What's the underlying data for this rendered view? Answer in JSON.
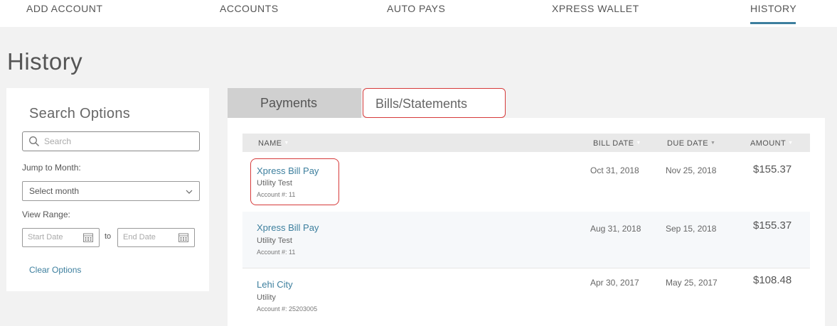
{
  "nav": {
    "items": [
      "ADD ACCOUNT",
      "ACCOUNTS",
      "AUTO PAYS",
      "XPRESS WALLET",
      "HISTORY"
    ],
    "active": "HISTORY"
  },
  "page_title": "History",
  "search_options": {
    "title": "Search Options",
    "search_placeholder": "Search",
    "jump_label": "Jump to Month:",
    "month_select": "Select month",
    "range_label": "View Range:",
    "start_placeholder": "Start Date",
    "to_label": "to",
    "end_placeholder": "End Date",
    "clear_label": "Clear Options"
  },
  "tabs": {
    "payments": "Payments",
    "bills": "Bills/Statements",
    "active": "Bills/Statements"
  },
  "table": {
    "columns": {
      "name": "NAME",
      "bill_date": "BILL DATE",
      "due_date": "DUE DATE",
      "amount": "AMOUNT"
    },
    "rows": [
      {
        "name": "Xpress Bill Pay",
        "sub": "Utility Test",
        "account": "Account #: 11",
        "bill_date": "Oct 31, 2018",
        "due_date": "Nov 25, 2018",
        "amount": "$155.37"
      },
      {
        "name": "Xpress Bill Pay",
        "sub": "Utility Test",
        "account": "Account #: 11",
        "bill_date": "Aug 31, 2018",
        "due_date": "Sep 15, 2018",
        "amount": "$155.37"
      },
      {
        "name": "Lehi City",
        "sub": "Utility",
        "account": "Account #: 25203005",
        "bill_date": "Apr 30, 2017",
        "due_date": "May 25, 2017",
        "amount": "$108.48"
      }
    ]
  },
  "colors": {
    "accent": "#3d7f9e",
    "highlight": "#d63a3a"
  }
}
